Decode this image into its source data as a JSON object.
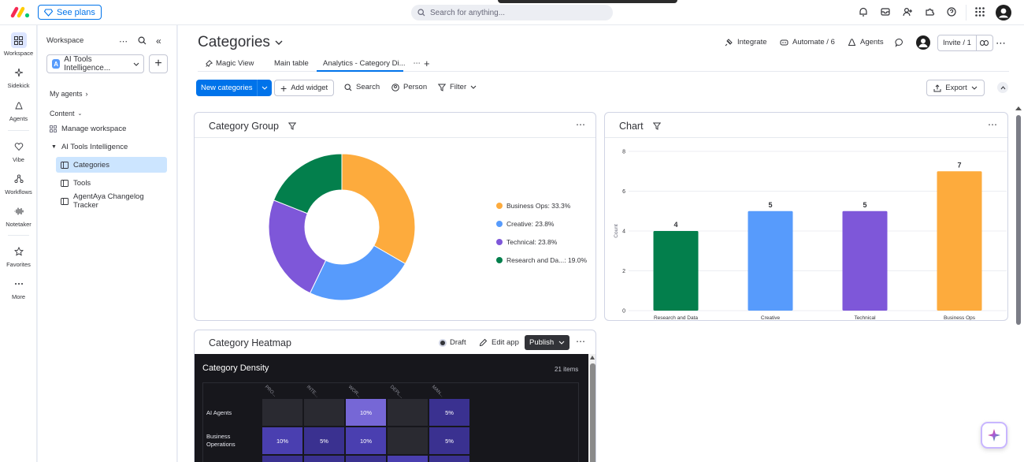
{
  "topbar": {
    "see_plans": "See plans",
    "search_placeholder": "Search for anything..."
  },
  "rail": {
    "items": [
      {
        "label": "Workspace",
        "icon": "grid-icon"
      },
      {
        "label": "Sidekick",
        "icon": "sparkle-icon"
      },
      {
        "label": "Agents",
        "icon": "agent-icon"
      },
      {
        "label": "Vibe",
        "icon": "heart-icon"
      },
      {
        "label": "Workflows",
        "icon": "workflow-icon"
      },
      {
        "label": "Notetaker",
        "icon": "waveform-icon"
      },
      {
        "label": "Favorites",
        "icon": "star-icon"
      },
      {
        "label": "More",
        "icon": "more-icon"
      }
    ]
  },
  "workspace": {
    "header": "Workspace",
    "selected": "AI Tools Intelligence...",
    "avatar_letter": "A",
    "my_agents": "My agents",
    "content": "Content",
    "manage": "Manage workspace",
    "folder": "AI Tools Intelligence",
    "boards": [
      "Categories",
      "Tools",
      "AgentAya Changelog Tracker"
    ]
  },
  "main": {
    "title": "Categories",
    "tabs": [
      "Magic View",
      "Main table",
      "Analytics - Category Di..."
    ],
    "actions": {
      "integrate": "Integrate",
      "automate": "Automate / 6",
      "agents": "Agents",
      "invite": "Invite / 1"
    },
    "toolbar": {
      "new_item": "New categories",
      "add_widget": "Add widget",
      "search": "Search",
      "person": "Person",
      "filter": "Filter",
      "export": "Export"
    }
  },
  "widgets": {
    "donut_title": "Category Group",
    "bar_title": "Chart",
    "heatmap_title": "Category Heatmap",
    "draft": "Draft",
    "edit_app": "Edit app",
    "publish": "Publish"
  },
  "chart_data": [
    {
      "type": "pie",
      "categories": [
        "Business Ops",
        "Creative",
        "Technical",
        "Research and Data"
      ],
      "values": [
        33.3,
        23.8,
        23.8,
        19.0
      ],
      "legend_labels": [
        "Business Ops: 33.3%",
        "Creative: 23.8%",
        "Technical: 23.8%",
        "Research and Da...: 19.0%"
      ],
      "colors": [
        "#fdab3d",
        "#579bfc",
        "#7e57d9",
        "#037f4c"
      ]
    },
    {
      "type": "bar",
      "categories": [
        "Research and Data",
        "Creative",
        "Technical",
        "Business Ops"
      ],
      "values": [
        4,
        5,
        5,
        7
      ],
      "colors": [
        "#037f4c",
        "#579bfc",
        "#7e57d9",
        "#fdab3d"
      ],
      "ylabel": "Count",
      "yticks": [
        0,
        2,
        4,
        6,
        8
      ],
      "ylim": [
        0,
        8
      ]
    },
    {
      "type": "heatmap",
      "title": "Category Density",
      "count_label": "21 items",
      "columns": [
        "PRO...",
        "INTE...",
        "WOR...",
        "DEPL...",
        "MAN..."
      ],
      "rows": [
        {
          "label": "AI Agents",
          "values": [
            "",
            "",
            "10%",
            "",
            "5%"
          ]
        },
        {
          "label": "Business Operations",
          "values": [
            "10%",
            "5%",
            "10%",
            "",
            "5%"
          ]
        }
      ]
    }
  ]
}
